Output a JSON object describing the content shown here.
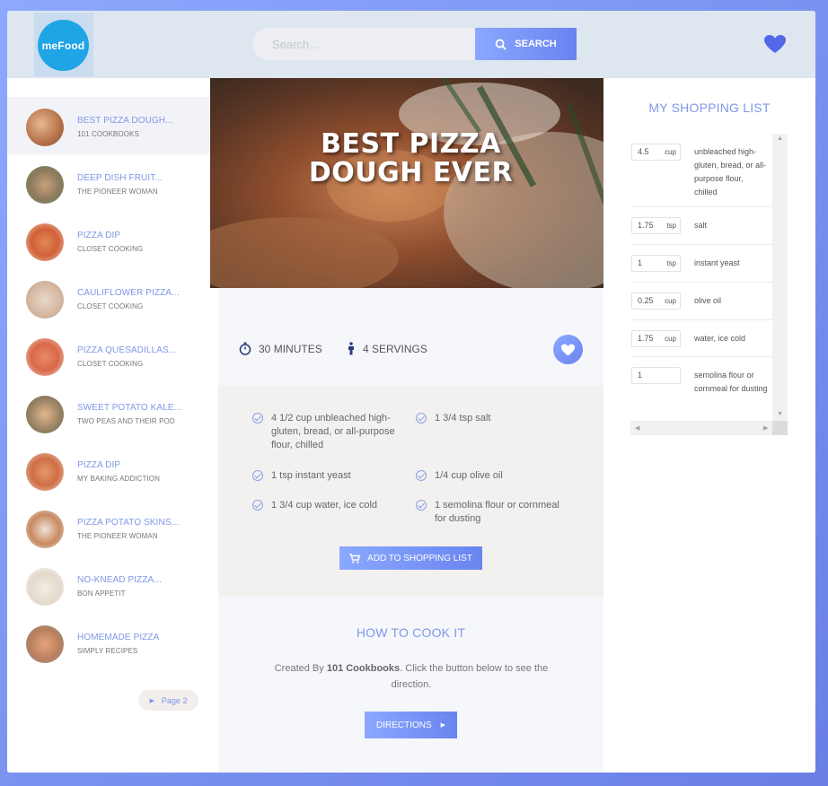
{
  "header": {
    "logo_text": "meFood",
    "search_placeholder": "Search...",
    "search_button": "SEARCH",
    "favorites_icon": "heart-icon"
  },
  "results": [
    {
      "title": "BEST PIZZA DOUGH...",
      "publisher": "101 COOKBOOKS",
      "active": true
    },
    {
      "title": "DEEP DISH FRUIT...",
      "publisher": "THE PIONEER WOMAN"
    },
    {
      "title": "PIZZA DIP",
      "publisher": "CLOSET COOKING"
    },
    {
      "title": "CAULIFLOWER PIZZA...",
      "publisher": "CLOSET COOKING"
    },
    {
      "title": "PIZZA QUESADILLAS...",
      "publisher": "CLOSET COOKING"
    },
    {
      "title": "SWEET POTATO KALE...",
      "publisher": "TWO PEAS AND THEIR POD"
    },
    {
      "title": "PIZZA DIP",
      "publisher": "MY BAKING ADDICTION"
    },
    {
      "title": "PIZZA POTATO SKINS...",
      "publisher": "THE PIONEER WOMAN"
    },
    {
      "title": "NO-KNEAD PIZZA...",
      "publisher": "BON APPETIT"
    },
    {
      "title": "HOMEMADE PIZZA",
      "publisher": "SIMPLY RECIPES"
    }
  ],
  "pagination": {
    "next_label": "Page 2"
  },
  "recipe": {
    "title_line1": "BEST PIZZA",
    "title_line2": "DOUGH EVER",
    "time_value": "30",
    "time_unit": "MINUTES",
    "servings_value": "4",
    "servings_unit": "SERVINGS",
    "ingredients": [
      "4 1/2 cup unbleached high-gluten, bread, or all-purpose flour, chilled",
      "1 3/4 tsp salt",
      "1 tsp instant yeast",
      "1/4 cup olive oil",
      "1 3/4 cup water, ice cold",
      "1 semolina flour or cornmeal for dusting"
    ],
    "add_to_list_button": "ADD TO SHOPPING LIST",
    "howto_heading": "HOW TO COOK IT",
    "howto_prefix": "Created By",
    "publisher": "101 Cookbooks",
    "howto_suffix": ". Click the button below to see the direction.",
    "directions_button": "DIRECTIONS"
  },
  "shopping_list": {
    "heading": "MY SHOPPING LIST",
    "items": [
      {
        "qty": "4.5",
        "unit": "cup",
        "name": "unbleached high-gluten, bread, or all-purpose flour, chilled"
      },
      {
        "qty": "1.75",
        "unit": "tsp",
        "name": "salt"
      },
      {
        "qty": "1",
        "unit": "tsp",
        "name": "instant yeast"
      },
      {
        "qty": "0.25",
        "unit": "cup",
        "name": "olive oil"
      },
      {
        "qty": "1.75",
        "unit": "cup",
        "name": "water, ice cold"
      },
      {
        "qty": "1",
        "unit": "",
        "name": "semolina flour or cornmeal for dusting"
      }
    ]
  },
  "colors": {
    "accent": "#7f97e6",
    "button_gradient_start": "#8aa8ff",
    "button_gradient_end": "#6a84ef",
    "logo": "#1fa5e6"
  }
}
